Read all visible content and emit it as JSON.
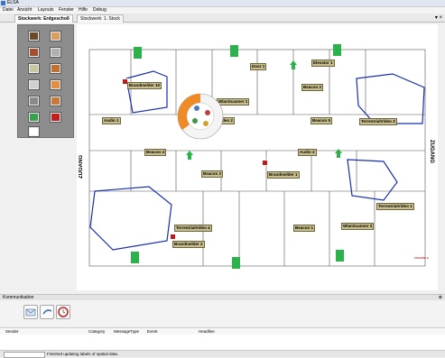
{
  "window": {
    "title": "ELSA"
  },
  "menu": [
    "Datei",
    "Ansicht",
    "Layouts",
    "Fenster",
    "Hilfe",
    "Debug"
  ],
  "tabs": [
    {
      "label": "Stockwerk: Erdgeschoß"
    },
    {
      "label": "Stockwerk: 1. Stock"
    }
  ],
  "map": {
    "labels": [
      "Door 1",
      "Elevator 1",
      "Brandmelder 10",
      "WlanScanner 1",
      "Beacon 2",
      "Audio 1",
      "Video 2",
      "Beacon 5",
      "TerrestrialVideo 3",
      "Beacon 4",
      "Beacon 3",
      "Audio 2",
      "Brandmelder 1",
      "TerrestrialVideo 1",
      "TerrestrialVideo 4",
      "Brandmelder 2",
      "Beacon 1",
      "WlanScanner 2"
    ],
    "side_text_left": "ZUGANG",
    "side_text_right": "ZUGANG",
    "corner_text": "ZUGANG A"
  },
  "komm": {
    "title": "Kommunikation",
    "columns": [
      "Sender",
      "Category",
      "MessageType",
      "Event",
      "Headline"
    ]
  },
  "status": {
    "message": "Finished updating labels of spatial data."
  }
}
